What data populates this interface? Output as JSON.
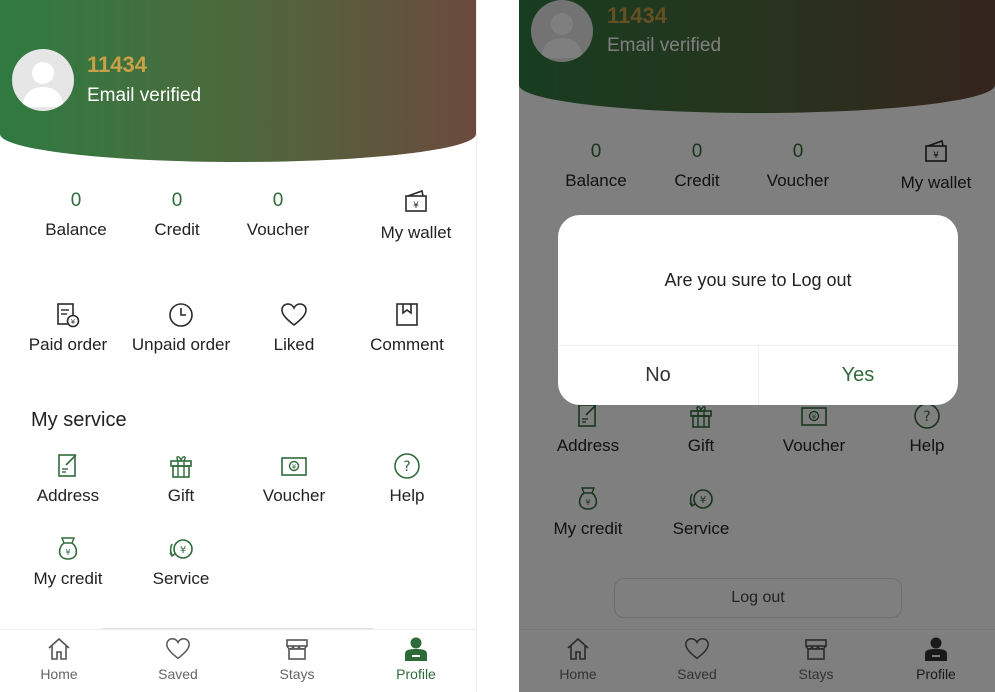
{
  "profile": {
    "user_id": "11434",
    "email_status": "Email verified"
  },
  "stats": [
    {
      "value": "0",
      "label": "Balance"
    },
    {
      "value": "0",
      "label": "Credit"
    },
    {
      "value": "0",
      "label": "Voucher"
    }
  ],
  "wallet": {
    "label": "My wallet",
    "icon": "wallet-icon"
  },
  "orders": [
    {
      "label": "Paid order",
      "icon": "paid-order-icon"
    },
    {
      "label": "Unpaid order",
      "icon": "clock-icon"
    },
    {
      "label": "Liked",
      "icon": "heart-icon"
    },
    {
      "label": "Comment",
      "icon": "bookmark-icon"
    }
  ],
  "service_section_title": "My service",
  "services": [
    {
      "label": "Address",
      "icon": "address-icon"
    },
    {
      "label": "Gift",
      "icon": "gift-icon"
    },
    {
      "label": "Voucher",
      "icon": "voucher-icon"
    },
    {
      "label": "Help",
      "icon": "help-icon"
    },
    {
      "label": "My credit",
      "icon": "money-bag-icon"
    },
    {
      "label": "Service",
      "icon": "yen-service-icon"
    }
  ],
  "logout_label": "Log out",
  "tabs": [
    {
      "label": "Home",
      "icon": "home-icon"
    },
    {
      "label": "Saved",
      "icon": "heart-icon"
    },
    {
      "label": "Stays",
      "icon": "store-icon"
    },
    {
      "label": "Profile",
      "icon": "person-icon",
      "active": true
    }
  ],
  "dialog": {
    "message": "Are you sure to Log out",
    "no_label": "No",
    "yes_label": "Yes"
  },
  "colors": {
    "accent": "#2f6b3a",
    "user_id": "#c9a047",
    "header_start": "#2f7a41",
    "header_end": "#6b4a3e"
  }
}
